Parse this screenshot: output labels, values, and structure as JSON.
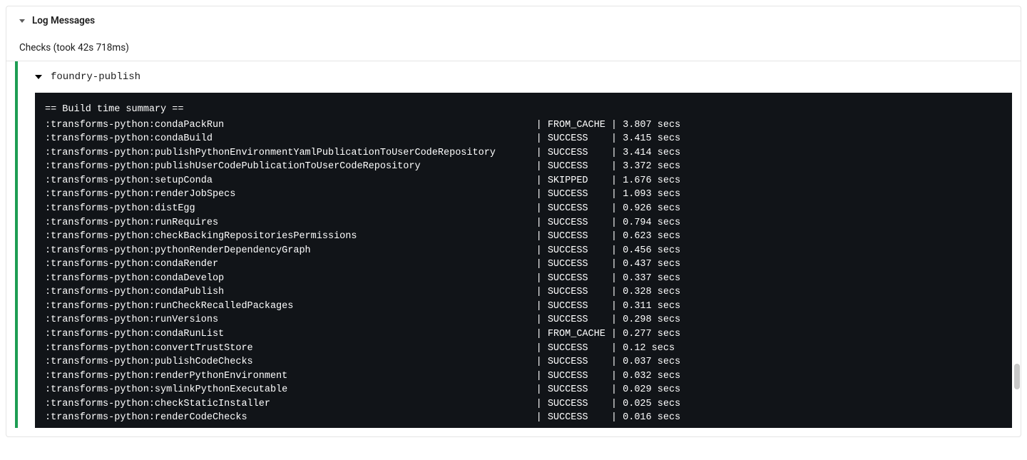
{
  "panel": {
    "title": "Log Messages",
    "subtitle": "Checks (took 42s 718ms)"
  },
  "section": {
    "name": "foundry-publish"
  },
  "terminal": {
    "header": "== Build time summary ==",
    "rows": [
      {
        "task": ":transforms-python:condaPackRun",
        "status": "FROM_CACHE",
        "time": "3.807 secs"
      },
      {
        "task": ":transforms-python:condaBuild",
        "status": "SUCCESS",
        "time": "3.415 secs"
      },
      {
        "task": ":transforms-python:publishPythonEnvironmentYamlPublicationToUserCodeRepository",
        "status": "SUCCESS",
        "time": "3.414 secs"
      },
      {
        "task": ":transforms-python:publishUserCodePublicationToUserCodeRepository",
        "status": "SUCCESS",
        "time": "3.372 secs"
      },
      {
        "task": ":transforms-python:setupConda",
        "status": "SKIPPED",
        "time": "1.676 secs"
      },
      {
        "task": ":transforms-python:renderJobSpecs",
        "status": "SUCCESS",
        "time": "1.093 secs"
      },
      {
        "task": ":transforms-python:distEgg",
        "status": "SUCCESS",
        "time": "0.926 secs"
      },
      {
        "task": ":transforms-python:runRequires",
        "status": "SUCCESS",
        "time": "0.794 secs"
      },
      {
        "task": ":transforms-python:checkBackingRepositoriesPermissions",
        "status": "SUCCESS",
        "time": "0.623 secs"
      },
      {
        "task": ":transforms-python:pythonRenderDependencyGraph",
        "status": "SUCCESS",
        "time": "0.456 secs"
      },
      {
        "task": ":transforms-python:condaRender",
        "status": "SUCCESS",
        "time": "0.437 secs"
      },
      {
        "task": ":transforms-python:condaDevelop",
        "status": "SUCCESS",
        "time": "0.337 secs"
      },
      {
        "task": ":transforms-python:condaPublish",
        "status": "SUCCESS",
        "time": "0.328 secs"
      },
      {
        "task": ":transforms-python:runCheckRecalledPackages",
        "status": "SUCCESS",
        "time": "0.311 secs"
      },
      {
        "task": ":transforms-python:runVersions",
        "status": "SUCCESS",
        "time": "0.298 secs"
      },
      {
        "task": ":transforms-python:condaRunList",
        "status": "FROM_CACHE",
        "time": "0.277 secs"
      },
      {
        "task": ":transforms-python:convertTrustStore",
        "status": "SUCCESS",
        "time": "0.12 secs"
      },
      {
        "task": ":transforms-python:publishCodeChecks",
        "status": "SUCCESS",
        "time": "0.037 secs"
      },
      {
        "task": ":transforms-python:renderPythonEnvironment",
        "status": "SUCCESS",
        "time": "0.032 secs"
      },
      {
        "task": ":transforms-python:symlinkPythonExecutable",
        "status": "SUCCESS",
        "time": "0.029 secs"
      },
      {
        "task": ":transforms-python:checkStaticInstaller",
        "status": "SUCCESS",
        "time": "0.025 secs"
      },
      {
        "task": ":transforms-python:renderCodeChecks",
        "status": "SUCCESS",
        "time": "0.016 secs"
      }
    ]
  }
}
